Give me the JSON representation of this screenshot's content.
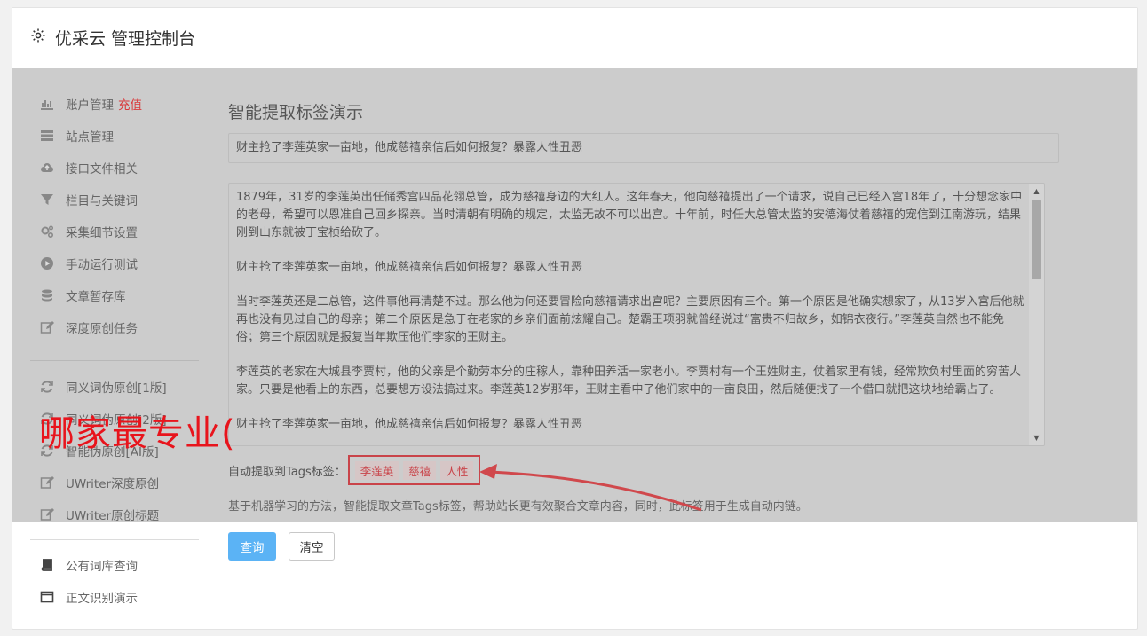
{
  "header": {
    "title": "优采云 管理控制台",
    "icon": "gear-icon"
  },
  "sidebar": {
    "items": [
      {
        "label": "账户管理",
        "badge": "充值",
        "icon": "bar-chart-icon"
      },
      {
        "label": "站点管理",
        "icon": "server-icon"
      },
      {
        "label": "接口文件相关",
        "icon": "cloud-upload-icon"
      },
      {
        "label": "栏目与关键词",
        "icon": "filter-icon"
      },
      {
        "label": "采集细节设置",
        "icon": "gears-icon"
      },
      {
        "label": "手动运行测试",
        "icon": "play-circle-icon"
      },
      {
        "label": "文章暂存库",
        "icon": "database-icon"
      },
      {
        "label": "深度原创任务",
        "icon": "edit-icon"
      },
      {
        "label": "同义词伪原创[1版]",
        "icon": "refresh-icon"
      },
      {
        "label": "同义词伪原创[2版]",
        "icon": "refresh-icon"
      },
      {
        "label": "智能伪原创[AI版]",
        "icon": "refresh-icon"
      },
      {
        "label": "UWriter深度原创",
        "icon": "edit-icon"
      },
      {
        "label": "UWriter原创标题",
        "icon": "edit-icon"
      },
      {
        "label": "公有词库查询",
        "icon": "book-icon"
      },
      {
        "label": "正文识别演示",
        "icon": "window-icon"
      }
    ]
  },
  "main": {
    "section_title": "智能提取标签演示",
    "title_value": "财主抢了李莲英家一亩地，他成慈禧亲信后如何报复？暴露人性丑恶",
    "content_paragraphs": [
      "1879年，31岁的李莲英出任储秀宫四品花翎总管，成为慈禧身边的大红人。这年春天，他向慈禧提出了一个请求，说自己已经入宫18年了，十分想念家中的老母，希望可以恩准自己回乡探亲。当时清朝有明确的规定，太监无故不可以出宫。十年前，时任大总管太监的安德海仗着慈禧的宠信到江南游玩，结果刚到山东就被丁宝桢给砍了。",
      "财主抢了李莲英家一亩地，他成慈禧亲信后如何报复？暴露人性丑恶",
      "当时李莲英还是二总管，这件事他再清楚不过。那么他为何还要冒险向慈禧请求出宫呢？主要原因有三个。第一个原因是他确实想家了，从13岁入宫后他就再也没有见过自己的母亲；第二个原因是急于在老家的乡亲们面前炫耀自己。楚霸王项羽就曾经说过“富贵不归故乡，如锦衣夜行。”李莲英自然也不能免俗；第三个原因就是报复当年欺压他们李家的王财主。",
      "李莲英的老家在大城县李贾村，他的父亲是个勤劳本分的庄稼人，靠种田养活一家老小。李贾村有一个王姓财主，仗着家里有钱，经常欺负村里面的穷苦人家。只要是他看上的东西，总要想方设法搞过来。李莲英12岁那年，王财主看中了他们家中的一亩良田，然后随便找了一个借口就把这块地给霸占了。",
      "财主抢了李莲英家一亩地，他成慈禧亲信后如何报复？暴露人性丑恶"
    ],
    "tags_label": "自动提取到Tags标签：",
    "tags": [
      "李莲英",
      "慈禧",
      "人性"
    ],
    "description": "基于机器学习的方法，智能提取文章Tags标签，帮助站长更有效聚合文章内容，同时，此标签用于生成自动内链。",
    "buttons": {
      "query": "查询",
      "clear": "清空"
    }
  },
  "overlay": {
    "text": "哪家最专业(",
    "color": "#e8141c"
  },
  "colors": {
    "accent_blue": "#5bb3f5",
    "tag_red": "#c9444a",
    "recharge_red": "#d9383a"
  }
}
